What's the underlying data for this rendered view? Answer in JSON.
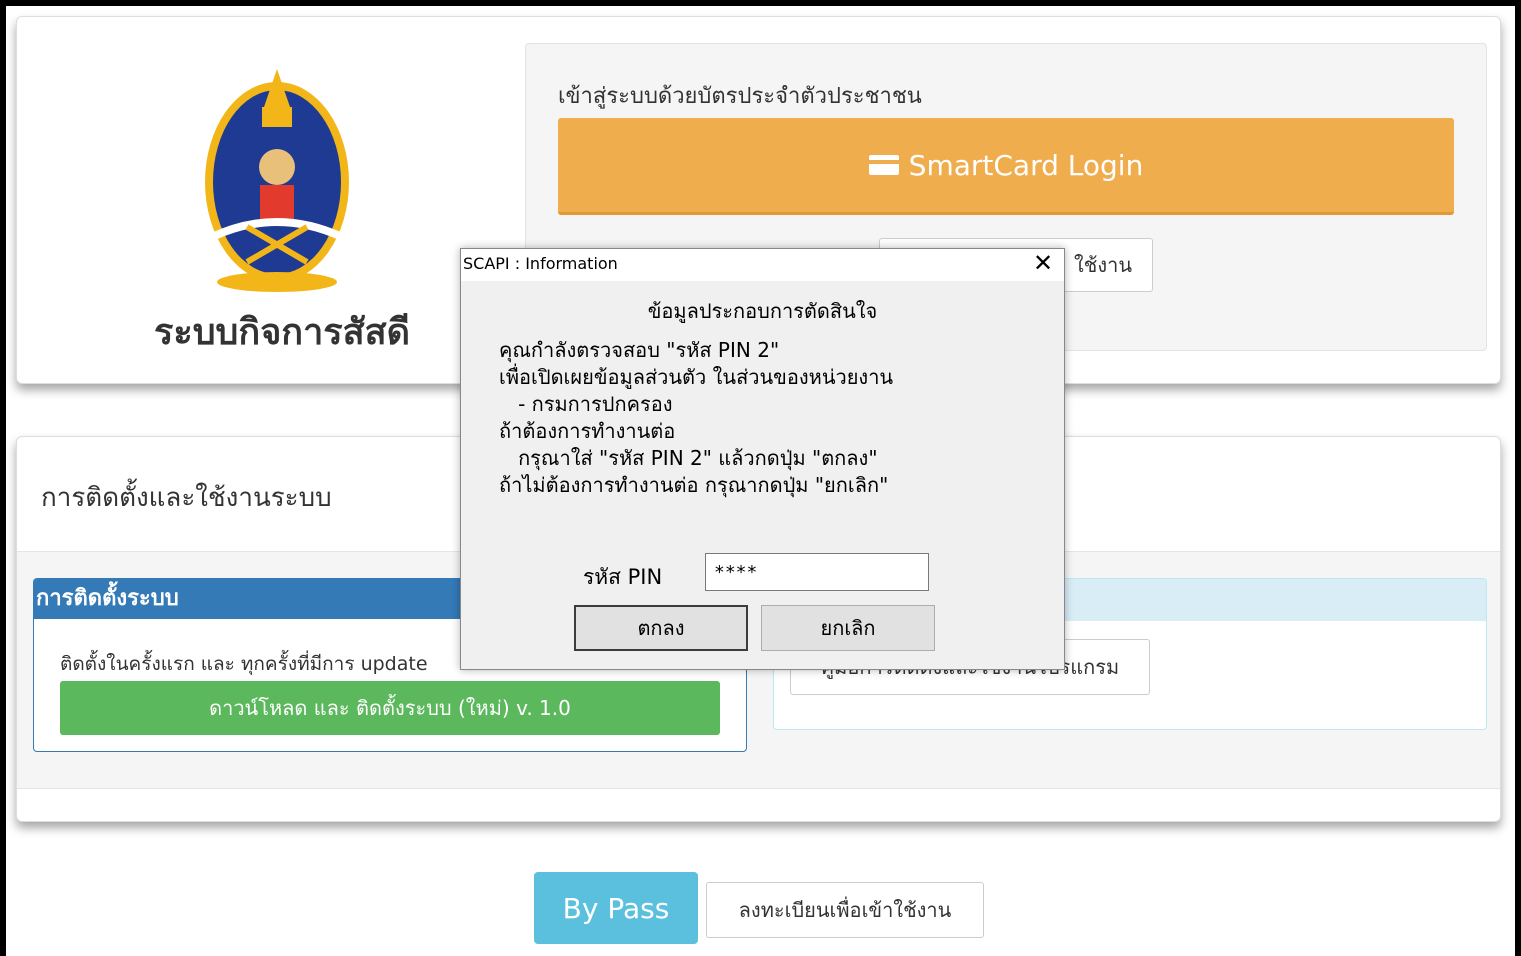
{
  "brand": {
    "system_title": "ระบบกิจการสัสดี"
  },
  "login": {
    "heading": "เข้าสู่ระบบด้วยบัตรประจำตัวประชาชน",
    "smartcard_label": "SmartCard Login",
    "register_label": "ใช้งาน"
  },
  "install": {
    "title": "การติดตั้งและใช้งานระบบ",
    "setup_header": "การติดตั้งระบบ",
    "setup_desc": "ติดตั้งในครั้งแรก และ ทุกครั้งที่มีการ update",
    "download_label": "ดาวน์โหลด และ ติดตั้งระบบ (ใหม่) v. 1.0",
    "manual_label": "คู่มือการติดตั้งและใช้งานโปรแกรม"
  },
  "bottom": {
    "bypass_label": "By Pass",
    "register_label": "ลงทะเบียนเพื่อเข้าใช้งาน"
  },
  "dialog": {
    "title": "SCAPI : Information",
    "close_glyph": "✕",
    "heading": "ข้อมูลประกอบการตัดสินใจ",
    "line1": "คุณกำลังตรวจสอบ \"รหัส PIN 2\"",
    "line2": "เพื่อเปิดเผยข้อมูลส่วนตัว ในส่วนของหน่วยงาน",
    "line3": "   - กรมการปกครอง",
    "line4": "ถ้าต้องการทำงานต่อ",
    "line5": "   กรุณาใส่ \"รหัส PIN 2\" แล้วกดปุ่ม \"ตกลง\"",
    "line6": "ถ้าไม่ต้องการทำงานต่อ กรุณากดปุ่ม \"ยกเลิก\"",
    "pin_label": "รหัส PIN",
    "pin_value": "****",
    "ok_label": "ตกลง",
    "cancel_label": "ยกเลิก"
  },
  "colors": {
    "warning": "#f0ad4e",
    "success": "#5cb85c",
    "primary": "#337ab7",
    "info": "#5bc0de"
  }
}
